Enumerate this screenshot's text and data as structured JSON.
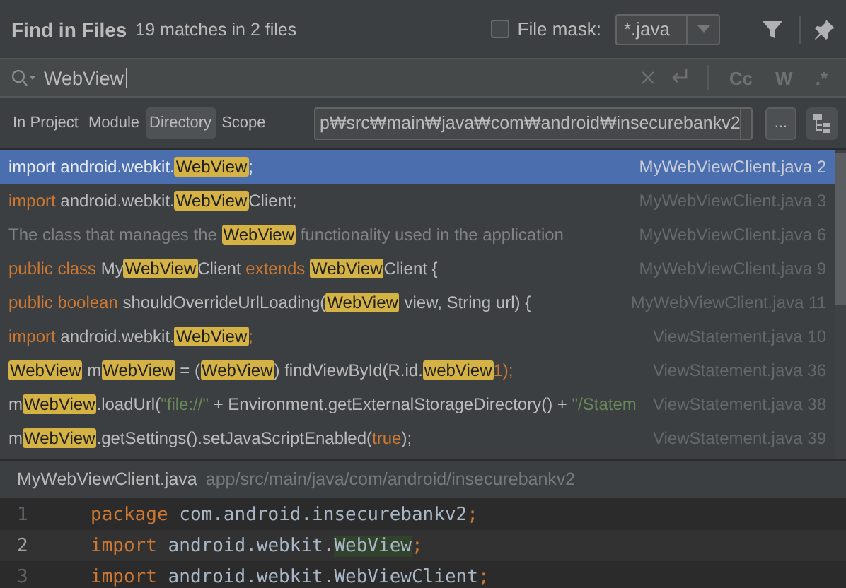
{
  "header": {
    "title": "Find in Files",
    "summary": "19 matches in 2 files",
    "file_mask": {
      "label": "File mask:",
      "checked": false,
      "value": "*.java"
    }
  },
  "search": {
    "query": "WebView",
    "options": [
      {
        "label": "Cc"
      },
      {
        "label": "W"
      },
      {
        "label": ".*"
      }
    ]
  },
  "scope": {
    "tabs": [
      {
        "label": "In Project",
        "selected": false
      },
      {
        "label": "Module",
        "selected": false
      },
      {
        "label": "Directory",
        "selected": true
      },
      {
        "label": "Scope",
        "selected": false
      }
    ],
    "path": "p₩src₩main₩java₩com₩android₩insecurebankv2",
    "browse_label": "..."
  },
  "results": [
    {
      "selected": true,
      "file": "MyWebViewClient.java",
      "line": "2",
      "segments": [
        {
          "kind": "keyword",
          "text": "import"
        },
        {
          "kind": "plain",
          "text": " android.webkit."
        },
        {
          "kind": "match",
          "text": "WebView"
        },
        {
          "kind": "keyword",
          "text": ";"
        }
      ]
    },
    {
      "selected": false,
      "file": "MyWebViewClient.java",
      "line": "3",
      "segments": [
        {
          "kind": "keyword",
          "text": "import"
        },
        {
          "kind": "plain",
          "text": " android.webkit."
        },
        {
          "kind": "match",
          "text": "WebView"
        },
        {
          "kind": "plain",
          "text": "Client;"
        }
      ]
    },
    {
      "selected": false,
      "file": "MyWebViewClient.java",
      "line": "6",
      "segments": [
        {
          "kind": "comment",
          "text": "The class that manages the "
        },
        {
          "kind": "match",
          "text": "WebView"
        },
        {
          "kind": "comment",
          "text": " functionality used in the application"
        }
      ]
    },
    {
      "selected": false,
      "file": "MyWebViewClient.java",
      "line": "9",
      "segments": [
        {
          "kind": "keyword",
          "text": "public class"
        },
        {
          "kind": "plain",
          "text": " My"
        },
        {
          "kind": "match",
          "text": "WebView"
        },
        {
          "kind": "plain",
          "text": "Client "
        },
        {
          "kind": "keyword",
          "text": "extends "
        },
        {
          "kind": "match",
          "text": "WebView"
        },
        {
          "kind": "plain",
          "text": "Client {"
        }
      ]
    },
    {
      "selected": false,
      "file": "MyWebViewClient.java",
      "line": "11",
      "segments": [
        {
          "kind": "keyword",
          "text": "public boolean"
        },
        {
          "kind": "plain",
          "text": " shouldOverrideUrlLoading("
        },
        {
          "kind": "match",
          "text": "WebView"
        },
        {
          "kind": "plain",
          "text": " view, String url) {"
        }
      ]
    },
    {
      "selected": false,
      "file": "ViewStatement.java",
      "line": "10",
      "segments": [
        {
          "kind": "keyword",
          "text": "import"
        },
        {
          "kind": "plain",
          "text": " android.webkit."
        },
        {
          "kind": "match",
          "text": "WebView"
        },
        {
          "kind": "keyword",
          "text": ";"
        }
      ]
    },
    {
      "selected": false,
      "file": "ViewStatement.java",
      "line": "36",
      "segments": [
        {
          "kind": "match",
          "text": "WebView"
        },
        {
          "kind": "plain",
          "text": " m"
        },
        {
          "kind": "match",
          "text": "WebView"
        },
        {
          "kind": "plain",
          "text": " = ("
        },
        {
          "kind": "match",
          "text": "WebView"
        },
        {
          "kind": "plain",
          "text": ") findViewById(R.id."
        },
        {
          "kind": "match",
          "text": "webView"
        },
        {
          "kind": "keyword",
          "text": "1);"
        }
      ]
    },
    {
      "selected": false,
      "file": "ViewStatement.java",
      "line": "38",
      "segments": [
        {
          "kind": "plain",
          "text": "m"
        },
        {
          "kind": "match",
          "text": "WebView"
        },
        {
          "kind": "plain",
          "text": ".loadUrl("
        },
        {
          "kind": "string",
          "text": "\"file://\""
        },
        {
          "kind": "plain",
          "text": " + Environment.getExternalStorageDirectory() + "
        },
        {
          "kind": "string",
          "text": "\"/Statem"
        }
      ]
    },
    {
      "selected": false,
      "file": "ViewStatement.java",
      "line": "39",
      "segments": [
        {
          "kind": "plain",
          "text": "m"
        },
        {
          "kind": "match",
          "text": "WebView"
        },
        {
          "kind": "plain",
          "text": ".getSettings().setJavaScriptEnabled("
        },
        {
          "kind": "keyword",
          "text": "true"
        },
        {
          "kind": "plain",
          "text": ");"
        }
      ]
    }
  ],
  "preview": {
    "file": "MyWebViewClient.java",
    "path": "app/src/main/java/com/android/insecurebankv2",
    "lines": [
      {
        "number": "1",
        "current": false,
        "segments": [
          {
            "kind": "keyword",
            "text": "package"
          },
          {
            "kind": "plain",
            "text": " com.android.insecurebankv2"
          },
          {
            "kind": "keyword",
            "text": ";"
          }
        ]
      },
      {
        "number": "2",
        "current": true,
        "segments": [
          {
            "kind": "keyword",
            "text": "import"
          },
          {
            "kind": "plain",
            "text": " android.webkit."
          },
          {
            "kind": "match",
            "text": "WebView"
          },
          {
            "kind": "keyword",
            "text": ";"
          }
        ]
      },
      {
        "number": "3",
        "current": false,
        "segments": [
          {
            "kind": "keyword",
            "text": "import"
          },
          {
            "kind": "plain",
            "text": " android.webkit.WebViewClient"
          },
          {
            "kind": "keyword",
            "text": ";"
          }
        ]
      }
    ]
  }
}
